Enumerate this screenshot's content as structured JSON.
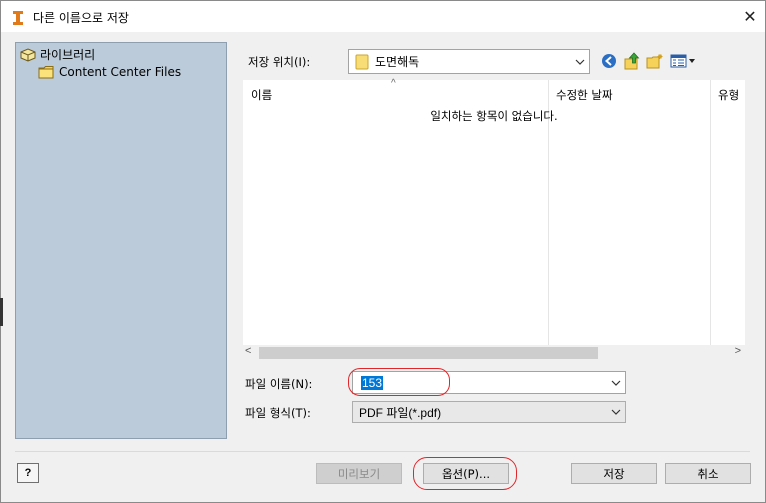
{
  "window": {
    "title": "다른 이름으로 저장",
    "close_glyph": "✕"
  },
  "sidebar": {
    "root_label": "라이브러리",
    "child_label": "Content Center Files"
  },
  "location": {
    "label": "저장 위치(I):",
    "value": "도면해독"
  },
  "file_list": {
    "columns": [
      "이름",
      "수정한 날짜",
      "유형"
    ],
    "empty_message": "일치하는 항목이 없습니다.",
    "sort_glyph": "^"
  },
  "filename": {
    "label": "파일 이름(N):",
    "value": "153"
  },
  "filetype": {
    "label": "파일 형식(T):",
    "value": "PDF 파일(*.pdf)"
  },
  "buttons": {
    "help": "?",
    "preview": "미리보기",
    "options": "옵션(P)...",
    "save": "저장",
    "cancel": "취소"
  },
  "icons": {
    "app": "inventor-app-icon",
    "back": "back-arrow-icon",
    "up": "up-folder-icon",
    "new_folder": "new-folder-icon",
    "view": "view-menu-icon"
  },
  "colors": {
    "sidebar_bg": "#bccbd9",
    "highlight_ring": "#e0262a",
    "selection": "#0078d7"
  }
}
